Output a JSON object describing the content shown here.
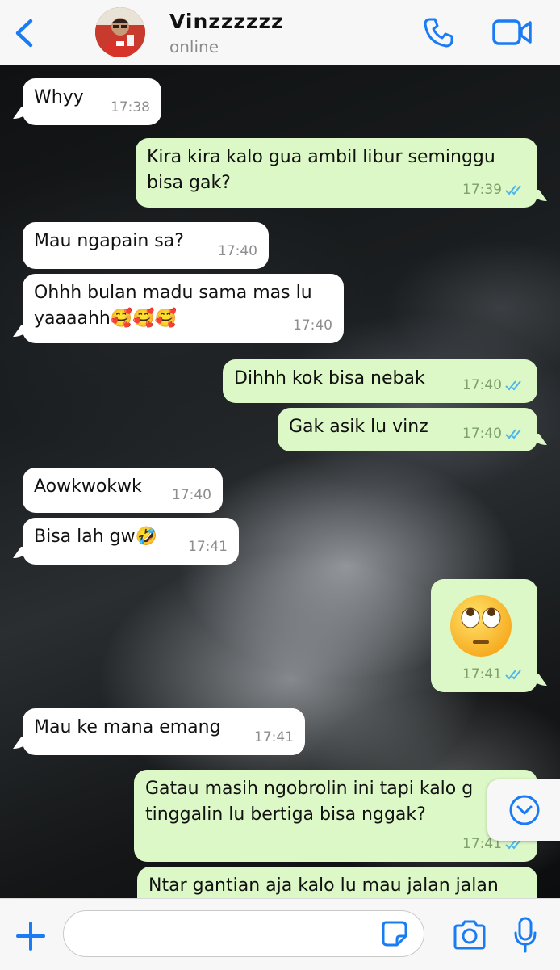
{
  "header": {
    "contact_name": "Vinzzzzzz",
    "status": "online"
  },
  "colors": {
    "accent": "#1a7cf5",
    "incoming_bubble": "#ffffff",
    "outgoing_bubble": "#dcf8c6",
    "read_ticks": "#4fb6ec"
  },
  "messages": [
    {
      "direction": "in",
      "text": "Whyy",
      "time": "17:38"
    },
    {
      "direction": "out",
      "text": "Kira kira kalo gua ambil libur seminggu bisa gak?",
      "time": "17:39",
      "read": true
    },
    {
      "direction": "in",
      "text": "Mau ngapain sa?",
      "time": "17:40"
    },
    {
      "direction": "in",
      "text": "Ohhh bulan madu sama mas lu yaaaahh🥰🥰🥰",
      "time": "17:40"
    },
    {
      "direction": "out",
      "text": "Dihhh kok bisa nebak",
      "time": "17:40",
      "read": true
    },
    {
      "direction": "out",
      "text": "Gak asik lu vinz",
      "time": "17:40",
      "read": true
    },
    {
      "direction": "in",
      "text": "Aowkwokwk",
      "time": "17:40"
    },
    {
      "direction": "in",
      "text": "Bisa lah gw🤣",
      "time": "17:41"
    },
    {
      "direction": "out",
      "text": "🙄",
      "time": "17:41",
      "read": true
    },
    {
      "direction": "in",
      "text": "Mau ke mana emang",
      "time": "17:41"
    },
    {
      "direction": "out",
      "text": "Gatau masih ngobrolin ini tapi kalo g tinggalin lu bertiga bisa nggak?",
      "time": "17:41",
      "read": true
    },
    {
      "direction": "out",
      "text": "Ntar gantian aja kalo lu mau jalan jalan",
      "time": "",
      "read": false
    }
  ],
  "composer": {
    "value": "",
    "placeholder": ""
  },
  "icons": {
    "back": "chevron-left-icon",
    "call": "phone-icon",
    "video": "video-camera-icon",
    "scroll": "chevron-down-circle-icon",
    "plus": "plus-icon",
    "sticker": "sticker-icon",
    "camera": "camera-icon",
    "mic": "microphone-icon"
  }
}
